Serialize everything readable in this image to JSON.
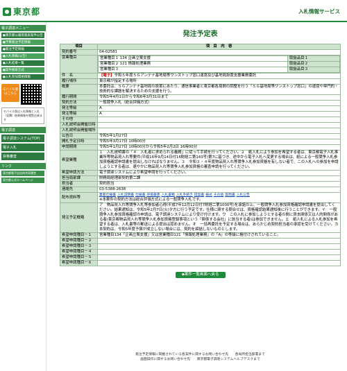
{
  "header": {
    "logo_text": "東京都",
    "system_title": "入札情報サービス"
  },
  "sidebar": {
    "section1": "電子調達メニュー",
    "items": [
      "●東京都公報等発表案件公告",
      "●予算発注予定情報",
      "●発注予定情報",
      "●入札情報(公告)",
      "●入札結果一覧",
      "●案件検索方式",
      "●入札参加資格情報"
    ],
    "mobile": {
      "label": "モバイル版はこちら"
    },
    "note": "モバイル版は入札情報と入札（見積）結果情報を閲覧出来ます",
    "section2": "電子調達",
    "links": [
      "電子調達システム(TOP)",
      "電子入札",
      "資格審査"
    ],
    "section3": "リンク",
    "small_links": [
      "東京都電子自治体共同運営",
      "東京都公式ホームページ"
    ]
  },
  "page": {
    "title": "発注予定表",
    "col_item": "項目",
    "col_content": "項　目　内　容"
  },
  "rows": {
    "contract_no": {
      "label": "契約番号",
      "value": "04-02581"
    },
    "business_type": {
      "label": "営業種目",
      "lines": [
        "営業種目１ 134 企画立案支援",
        "営業種目２ 121 情報処理業務",
        "営業種目３"
      ],
      "sides": [
        "取扱品目１",
        "取扱品目２",
        "取扱品目３"
      ]
    },
    "subject": {
      "label": "件　名",
      "tag": "【電子】",
      "value": "令和５年度５Ｇアンテナ基地局等ワンストップ窓口運営及び基地局設置支援業務委託"
    },
    "place": {
      "label": "履行場所",
      "value": "東京都が指定する場所"
    },
    "overview": {
      "label": "概要",
      "value": "本委託は、５Ｇアンテナ基地局の設置にあたり、通信事業者と東京都各局間の調整を行う「５Ｇ基地局等ワンストップ窓口」の運営や専門的・技術的な課題を解決するための支援を行う。"
    },
    "period": {
      "label": "履行期間",
      "value": "令和5年4月1日から令和6年3月31日まで"
    },
    "method": {
      "label": "契約方法",
      "value": "一般競争入札（総合評価方式）"
    },
    "dept": {
      "label": "発注等級",
      "value": "A"
    },
    "grade": {
      "label": "発注等級",
      "value": "A"
    },
    "other": {
      "label": "その他",
      "value": ""
    },
    "briefing_date": {
      "label": "入札説明会開催日時",
      "value": ""
    },
    "briefing_place": {
      "label": "入札説明会開催場所",
      "value": ""
    },
    "pub_date": {
      "label": "公告日",
      "value": "令和5年1月27日"
    },
    "open_date": {
      "label": "開札予定日時",
      "value": "令和5年3月17日 10時00分"
    },
    "apply_period": {
      "label": "申請期間",
      "value": "令和5年1月27日 10時00分から令和5年2月2日 16時00分"
    },
    "eligibility": {
      "label": "希望業種",
      "value": "１　入札説明書の「４　入札者に求められる義務」に従って手続を行ってください。２　紙入札により参加を希望する者は、東京都電子入札事業所等物品買入れ等要件(平成16年9月14日付16財経二第143号)第7に基づき、途中から電子入札へ変更する場合は、紙による一般競争入札参加資格確認申請書を提出しなければなりません。３　令和３・４年度物品買入れ等競争入札参加資格を有しない者で、この入札への参加を申請しようとする者は、速やかに物品買入れ等競争入札参加資格の審査申請を行ってください。"
    },
    "app_method": {
      "label": "希望申請方法",
      "value": "電子調達システムにより希望申請を行ってください。"
    },
    "contact_dept": {
      "label": "担当局部課",
      "value": "財務局経理部契約第二課"
    },
    "contact": {
      "label": "担当者",
      "value": "契約担当"
    },
    "phone": {
      "label": "連絡先",
      "value": "03-5388-2638"
    },
    "attachments": {
      "label": "配布資料等",
      "files": [
        "業者仕様書",
        "入札説明書",
        "仕様書",
        "評価基準",
        "入札書類",
        "入札手続き",
        "提案書",
        "様式",
        "その他",
        "質問書",
        "入札公告"
      ],
      "note": "※本案件の契約方法は総合評価方式による一般競争入札です。"
    },
    "conditions": {
      "label": "発注予定概略",
      "value": "ア　物品買入れ等競争入札等参加者心得(平成7年12月12日付7財経二第1000号)を承諾の上、一般競争入札参加資格確認申請書を提出してください。結果通知は、令和5年2月7日(火)夕方に行う予定です。仕様に関する問合せは、資格確認結果通知後に行うことができます。イ　一般競争入札参加資格確認の申請は、電子調達システムにより受け付けます。ウ　この入札に参加しようとする者の間に資本関係又は人的関係がある者(東京都物品買入れ等競争入札参加資格登録事項という「関係する会社」に該当する者)は参加できません。エ　紙入札による入札参加を希望する者は、入札書等の郵送による提出は認めません。オ　一括再委託を予定する場合は、あらかじめ契約担当者の承認を受けてください。カ　本契約は、令和5年度予算が成立しない場合には、契約を締結しないものとします。"
    },
    "req1": {
      "label": "希望申請種目－１",
      "value": "営業種目134「企画立案支援」又は営業種目121「情報処理業務」の「A」の等級に格付けされていること。"
    },
    "req2": {
      "label": "希望申請種目－２",
      "value": ""
    },
    "req3": {
      "label": "希望申請種目－３",
      "value": ""
    },
    "req4": {
      "label": "希望申請種目－４",
      "value": ""
    },
    "req5": {
      "label": "希望申請種目－５",
      "value": ""
    },
    "req6": {
      "label": "希望申請種目－６",
      "value": ""
    }
  },
  "back_button": "◆案件一覧画面へ戻る",
  "footer": {
    "line1": "発注予定情報に掲載されている各案件に関するお問い合わせ先　　各局所担当部署まで",
    "line2": "画面操作に関するお問い合わせ先　　東京都電子調達システムヘルプデスクまで"
  }
}
